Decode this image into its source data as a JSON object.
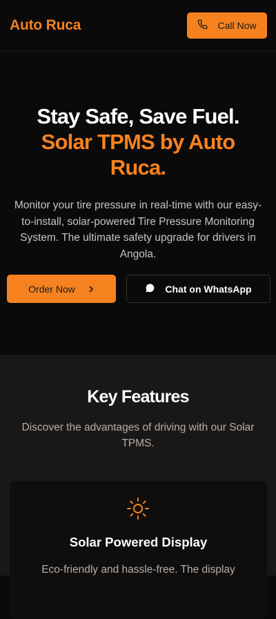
{
  "header": {
    "brand": "Auto Ruca",
    "call_label": "Call Now"
  },
  "hero": {
    "title_line1": "Stay Safe, Save Fuel.",
    "title_line2": "Solar TPMS by Auto Ruca.",
    "description": "Monitor your tire pressure in real-time with our easy-to-install, solar-powered Tire Pressure Monitoring System. The ultimate safety upgrade for drivers in Angola.",
    "order_label": "Order Now",
    "chat_label": "Chat on WhatsApp"
  },
  "features": {
    "title": "Key Features",
    "subtitle": "Discover the advantages of driving with our Solar TPMS.",
    "cards": [
      {
        "icon": "sun-icon",
        "title": "Solar Powered Display",
        "description": "Eco-friendly and hassle-free. The display"
      }
    ]
  },
  "colors": {
    "accent": "#f5821f",
    "background": "#0b0a0a",
    "section_background": "#1a1817"
  }
}
